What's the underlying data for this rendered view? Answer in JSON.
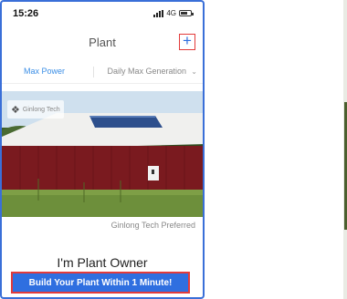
{
  "status": {
    "time": "15:26",
    "network": "4G"
  },
  "header": {
    "title": "Plant",
    "add_label": "+"
  },
  "tabs": [
    {
      "label": "Max Power",
      "active": true
    },
    {
      "label": "Daily Max Generation",
      "active": false
    }
  ],
  "hero": {
    "brand": "Ginlong Tech",
    "caption": "Ginlong Tech Preferred"
  },
  "promo": {
    "heading": "I'm Plant Owner",
    "button_label": "Build Your Plant Within 1 Minute!"
  },
  "colors": {
    "accent": "#2f6fe0",
    "highlight": "#e23b3b",
    "tab_active": "#3a8ee6"
  }
}
